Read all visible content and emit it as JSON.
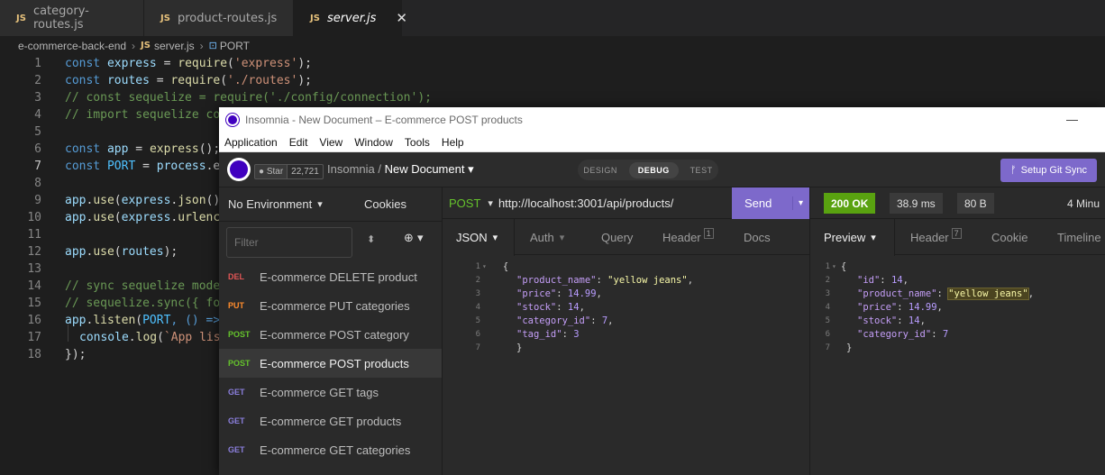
{
  "vscode": {
    "tabs": [
      {
        "name": "category-routes.js",
        "badge": "JS"
      },
      {
        "name": "product-routes.js",
        "badge": "JS"
      },
      {
        "name": "server.js",
        "badge": "JS"
      }
    ],
    "close_glyph": "✕",
    "breadcrumb": {
      "folder": "e-commerce-back-end",
      "file": "server.js",
      "symbol": "PORT",
      "file_badge": "JS",
      "symbol_icon": "⊡"
    },
    "line_numbers": [
      "1",
      "2",
      "3",
      "4",
      "5",
      "6",
      "7",
      "8",
      "9",
      "10",
      "11",
      "12",
      "13",
      "14",
      "15",
      "16",
      "17",
      "18"
    ],
    "code": {
      "l1": {
        "kw": "const",
        "var": "express",
        "op": " = ",
        "fn": "require",
        "p1": "(",
        "str": "'express'",
        "p2": ");"
      },
      "l2": {
        "kw": "const",
        "var": "routes",
        "op": " = ",
        "fn": "require",
        "p1": "(",
        "str": "'./routes'",
        "p2": ");"
      },
      "l3": "// const sequelize = require('./config/connection');",
      "l4": "// import sequelize co",
      "l6": {
        "kw": "const",
        "var": "app",
        "op": " = ",
        "fn": "express",
        "p": "();"
      },
      "l7": {
        "kw": "const",
        "const": "PORT",
        "op": " = ",
        "var": "process",
        "rest": ".en"
      },
      "l9": {
        "var": "app",
        "dot": ".",
        "fn": "use",
        "p1": "(",
        "var2": "express",
        "dot2": ".",
        "fn2": "json",
        "p2": "()"
      },
      "l10": {
        "var": "app",
        "dot": ".",
        "fn": "use",
        "p1": "(",
        "var2": "express",
        "dot2": ".",
        "fn2": "urlenc"
      },
      "l12": {
        "var": "app",
        "dot": ".",
        "fn": "use",
        "p1": "(",
        "var2": "routes",
        "p2": ");"
      },
      "l14": "// sync sequelize mode",
      "l15": "// sequelize.sync({ fo",
      "l16": {
        "var": "app",
        "dot": ".",
        "fn": "listen",
        "p1": "(",
        "const": "PORT",
        "rest": ", () =>"
      },
      "l17": {
        "var": "console",
        "dot": ".",
        "fn": "log",
        "p1": "(",
        "str": "`App lis"
      },
      "l18": "});"
    }
  },
  "insomnia": {
    "window_title": "Insomnia - New Document – E-commerce POST products",
    "minimize_glyph": "—",
    "menu": [
      "Application",
      "Edit",
      "View",
      "Window",
      "Tools",
      "Help"
    ],
    "github": {
      "star_label": "Star",
      "count": "22,721"
    },
    "breadcrumb": {
      "app": "Insomnia",
      "sep": " / ",
      "doc": "New Document",
      "caret": "▾"
    },
    "modes": [
      "DESIGN",
      "DEBUG",
      "TEST"
    ],
    "git_sync_label": "Setup Git Sync",
    "git_sync_icon": "ᚠ",
    "environment": "No Environment",
    "env_caret": "▾",
    "cookies_label": "Cookies",
    "filter_placeholder": "Filter",
    "sort_glyph": "⬍",
    "plus_glyph": "⊕ ▾",
    "requests": [
      {
        "method": "DEL",
        "name": "E-commerce DELETE product"
      },
      {
        "method": "PUT",
        "name": "E-commerce PUT categories"
      },
      {
        "method": "POST",
        "name": "E-commerce POST category"
      },
      {
        "method": "POST",
        "name": "E-commerce POST products"
      },
      {
        "method": "GET",
        "name": "E-commerce GET tags"
      },
      {
        "method": "GET",
        "name": "E-commerce GET products"
      },
      {
        "method": "GET",
        "name": "E-commerce GET categories"
      }
    ],
    "url_method": "POST",
    "url_caret": "▾",
    "url": "http://localhost:3001/api/products/",
    "send_label": "Send",
    "send_caret": "▾",
    "request_tabs": {
      "json": "JSON",
      "json_caret": "▾",
      "auth": "Auth",
      "auth_caret": "▾",
      "query": "Query",
      "header": "Header",
      "header_count": "1",
      "docs": "Docs"
    },
    "request_body": {
      "line_numbers": [
        "1",
        "2",
        "3",
        "4",
        "5",
        "6",
        "7"
      ],
      "fold_glyph": "▾",
      "open": "{",
      "close": "}",
      "fields": [
        {
          "key": "\"product_name\"",
          "value": "\"yellow jeans\"",
          "tail": ","
        },
        {
          "key": "\"price\"",
          "value": "14.99",
          "tail": ","
        },
        {
          "key": "\"stock\"",
          "value": "14",
          "tail": ","
        },
        {
          "key": "\"category_id\"",
          "value": "7",
          "tail": ","
        },
        {
          "key": "\"tag_id\"",
          "value": "3",
          "tail": ""
        }
      ]
    },
    "response": {
      "status": "200 OK",
      "time": "38.9 ms",
      "size": "80 B",
      "age": "4 Minu",
      "tabs": {
        "preview": "Preview",
        "preview_caret": "▾",
        "header": "Header",
        "header_count": "7",
        "cookie": "Cookie",
        "timeline": "Timeline"
      },
      "line_numbers": [
        "1",
        "2",
        "3",
        "4",
        "5",
        "6",
        "7"
      ],
      "fold_glyph": "▾",
      "open": "{",
      "close": "}",
      "fields": [
        {
          "key": "\"id\"",
          "value": "14",
          "tail": ","
        },
        {
          "key": "\"product_name\"",
          "value": "\"yellow jeans\"",
          "tail": ","
        },
        {
          "key": "\"price\"",
          "value": "14.99",
          "tail": ","
        },
        {
          "key": "\"stock\"",
          "value": "14",
          "tail": ","
        },
        {
          "key": "\"category_id\"",
          "value": "7",
          "tail": ""
        }
      ]
    }
  }
}
